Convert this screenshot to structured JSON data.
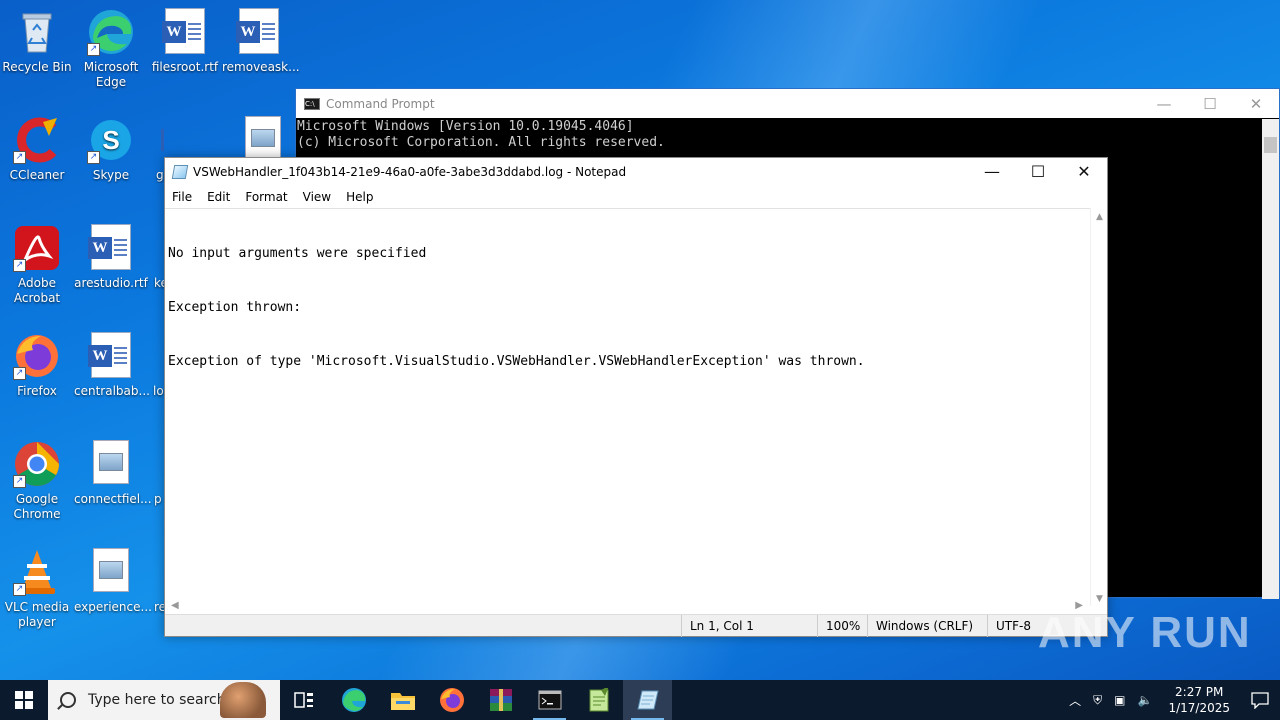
{
  "desktop": {
    "icons": [
      {
        "label": "Recycle Bin",
        "icon": "recycle-bin-icon"
      },
      {
        "label": "Microsoft Edge",
        "icon": "edge-icon"
      },
      {
        "label": "filesroot.rtf",
        "icon": "word-doc-icon"
      },
      {
        "label": "removeask...",
        "icon": "word-doc-icon"
      },
      {
        "label": "CCleaner",
        "icon": "ccleaner-icon"
      },
      {
        "label": "Skype",
        "icon": "skype-icon"
      },
      {
        "label": "g",
        "icon": "word-doc-icon"
      },
      {
        "label": "",
        "icon": "image-file-icon"
      },
      {
        "label": "Adobe Acrobat",
        "icon": "adobe-acrobat-icon"
      },
      {
        "label": "arestudio.rtf",
        "icon": "word-doc-icon"
      },
      {
        "label": "ke",
        "icon": "word-doc-icon"
      },
      {
        "label": "Firefox",
        "icon": "firefox-icon"
      },
      {
        "label": "centralbab...",
        "icon": "word-doc-icon"
      },
      {
        "label": "lo",
        "icon": "word-doc-icon"
      },
      {
        "label": "Google Chrome",
        "icon": "chrome-icon"
      },
      {
        "label": "connectfiel...",
        "icon": "image-file-icon"
      },
      {
        "label": "p",
        "icon": "image-file-icon"
      },
      {
        "label": "VLC media player",
        "icon": "vlc-icon"
      },
      {
        "label": "experience...",
        "icon": "image-file-icon"
      },
      {
        "label": "re",
        "icon": "image-file-icon"
      }
    ]
  },
  "cmd": {
    "title": "Command Prompt",
    "lines": [
      "Microsoft Windows [Version 10.0.19045.4046]",
      "(c) Microsoft Corporation. All rights reserved."
    ],
    "controls": {
      "minimize": "—",
      "maximize": "☐",
      "close": "✕"
    }
  },
  "notepad": {
    "title": "VSWebHandler_1f043b14-21e9-46a0-a0fe-3abe3d3ddabd.log - Notepad",
    "menu": [
      "File",
      "Edit",
      "Format",
      "View",
      "Help"
    ],
    "content": [
      "No input arguments were specified",
      "Exception thrown:",
      "Exception of type 'Microsoft.VisualStudio.VSWebHandler.VSWebHandlerException' was thrown."
    ],
    "controls": {
      "minimize": "—",
      "maximize": "☐",
      "close": "✕"
    },
    "status": {
      "position": "Ln 1, Col 1",
      "zoom": "100%",
      "line_ending": "Windows (CRLF)",
      "encoding": "UTF-8"
    }
  },
  "watermark": "ANY RUN",
  "taskbar": {
    "search_placeholder": "Type here to search",
    "apps": [
      "task-view-icon",
      "edge-icon",
      "file-explorer-icon",
      "firefox-icon",
      "winrar-icon",
      "cmd-icon",
      "notepadpp-icon",
      "notepad-icon"
    ],
    "clock": {
      "time": "2:27 PM",
      "date": "1/17/2025"
    }
  }
}
